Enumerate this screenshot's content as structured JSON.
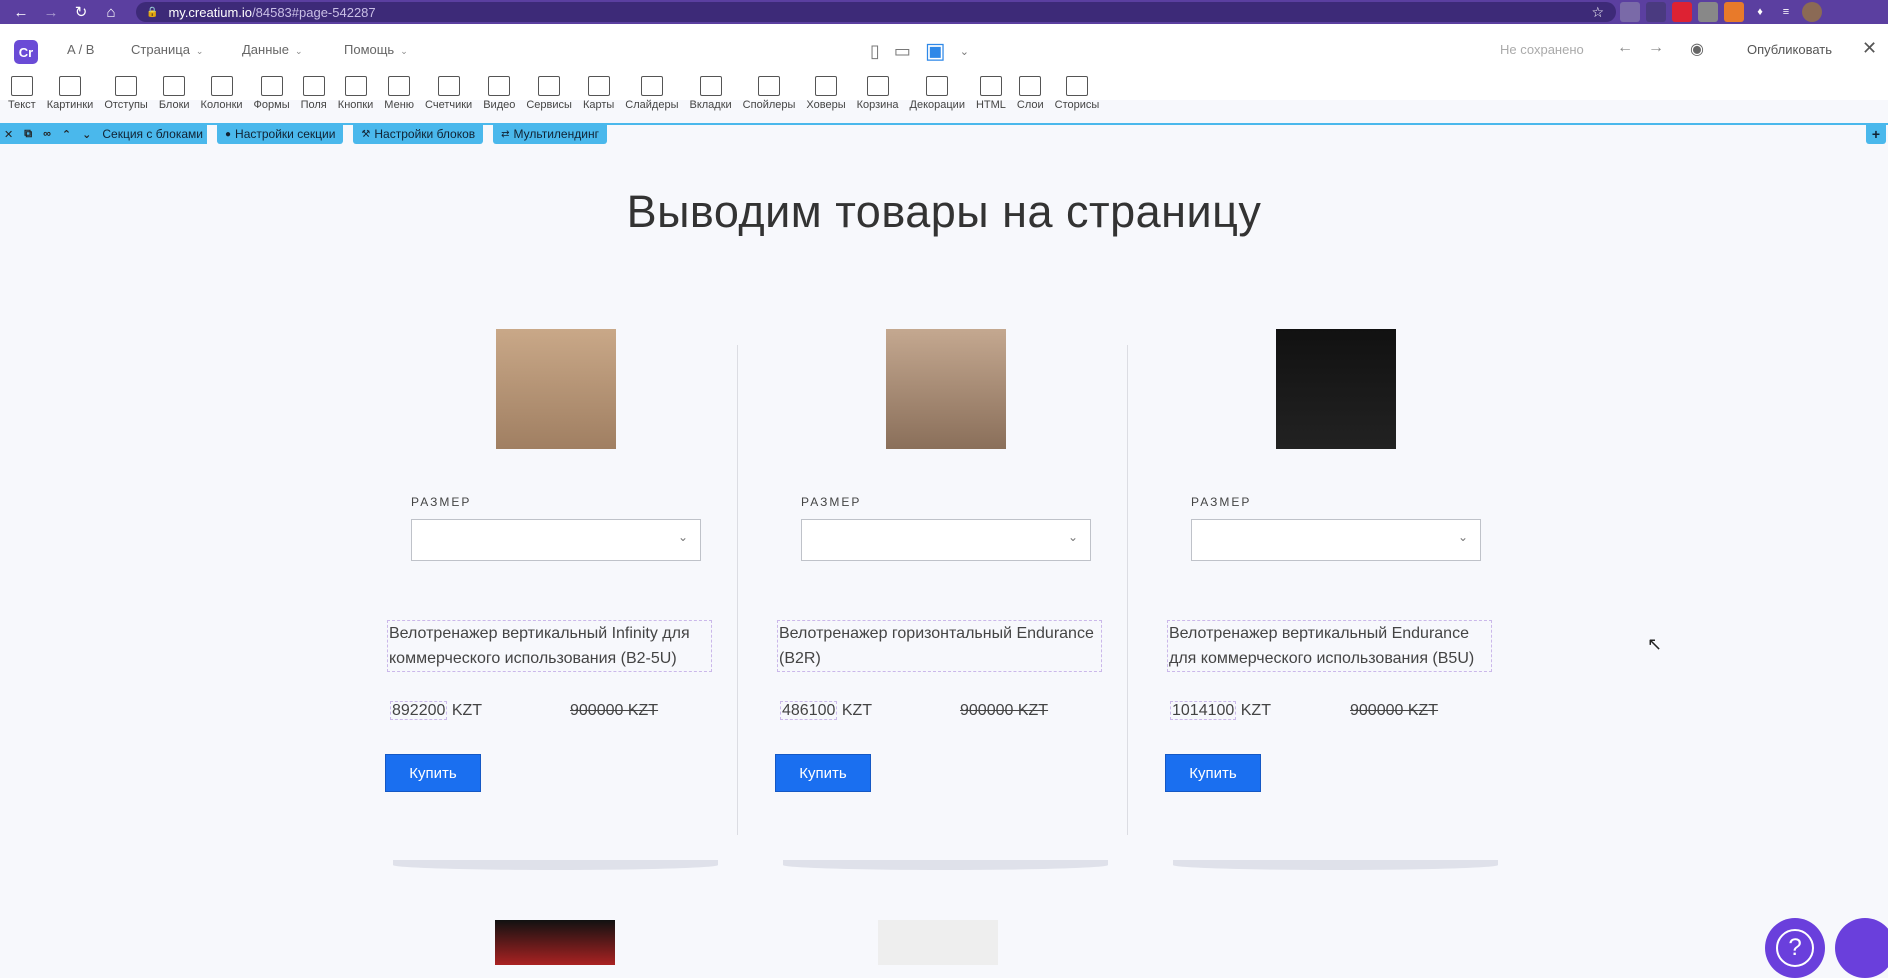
{
  "browser": {
    "url_host": "my.creatium.io",
    "url_path": "/84583#page-542287"
  },
  "editor": {
    "logo": "Cr",
    "ab": "A / B",
    "menu": [
      "Страница",
      "Данные",
      "Помощь"
    ],
    "status": "Не сохранено",
    "publish": "Опубликовать",
    "tools": [
      "Текст",
      "Картинки",
      "Отступы",
      "Блоки",
      "Колонки",
      "Формы",
      "Поля",
      "Кнопки",
      "Меню",
      "Счетчики",
      "Видео",
      "Сервисы",
      "Карты",
      "Слайдеры",
      "Вкладки",
      "Спойлеры",
      "Ховеры",
      "Корзина",
      "Декорации",
      "HTML",
      "Слои",
      "Сторисы"
    ]
  },
  "section_bar": {
    "section": "Секция с блоками",
    "section_settings": "Настройки секции",
    "block_settings": "Настройки блоков",
    "multilanding": "Мультилендинг"
  },
  "page": {
    "title": "Выводим товары на страницу",
    "size_label": "РАЗМЕР",
    "buy_label": "Купить",
    "products": [
      {
        "name": "Велотренажер вертикальный Infinity для коммерческого использования (B2-5U)",
        "price": "892200",
        "currency": "KZT",
        "old_price": "900000 KZT"
      },
      {
        "name": "Велотренажер горизонтальный Endurance (B2R)",
        "price": "486100",
        "currency": "KZT",
        "old_price": "900000 KZT"
      },
      {
        "name": "Велотренажер вертикальный Endurance для коммерческого использования (B5U)",
        "price": "1014100",
        "currency": "KZT",
        "old_price": "900000 KZT"
      }
    ]
  },
  "help_label": "?"
}
